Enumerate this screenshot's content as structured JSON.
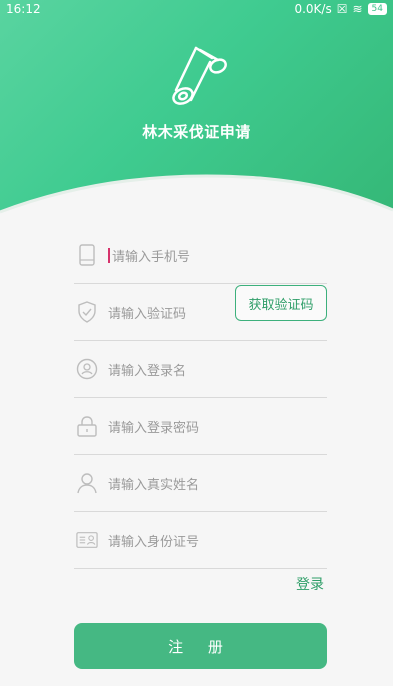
{
  "status_bar": {
    "time": "16:12",
    "speed": "0.0K/s",
    "battery": "54"
  },
  "header": {
    "title": "林木采伐证申请"
  },
  "form": {
    "phone_placeholder": "请输入手机号",
    "code_placeholder": "请输入验证码",
    "get_code_label": "获取验证码",
    "login_name_placeholder": "请输入登录名",
    "password_placeholder": "请输入登录密码",
    "real_name_placeholder": "请输入真实姓名",
    "id_card_placeholder": "请输入身份证号"
  },
  "links": {
    "login": "登录"
  },
  "buttons": {
    "register": "注 册"
  },
  "colors": {
    "brand": "#45b883",
    "hero_start": "#59d4a0",
    "hero_end": "#35b877"
  },
  "icons": [
    "phone-icon",
    "shield-check-icon",
    "user-circle-icon",
    "lock-icon",
    "person-icon",
    "id-card-icon"
  ]
}
